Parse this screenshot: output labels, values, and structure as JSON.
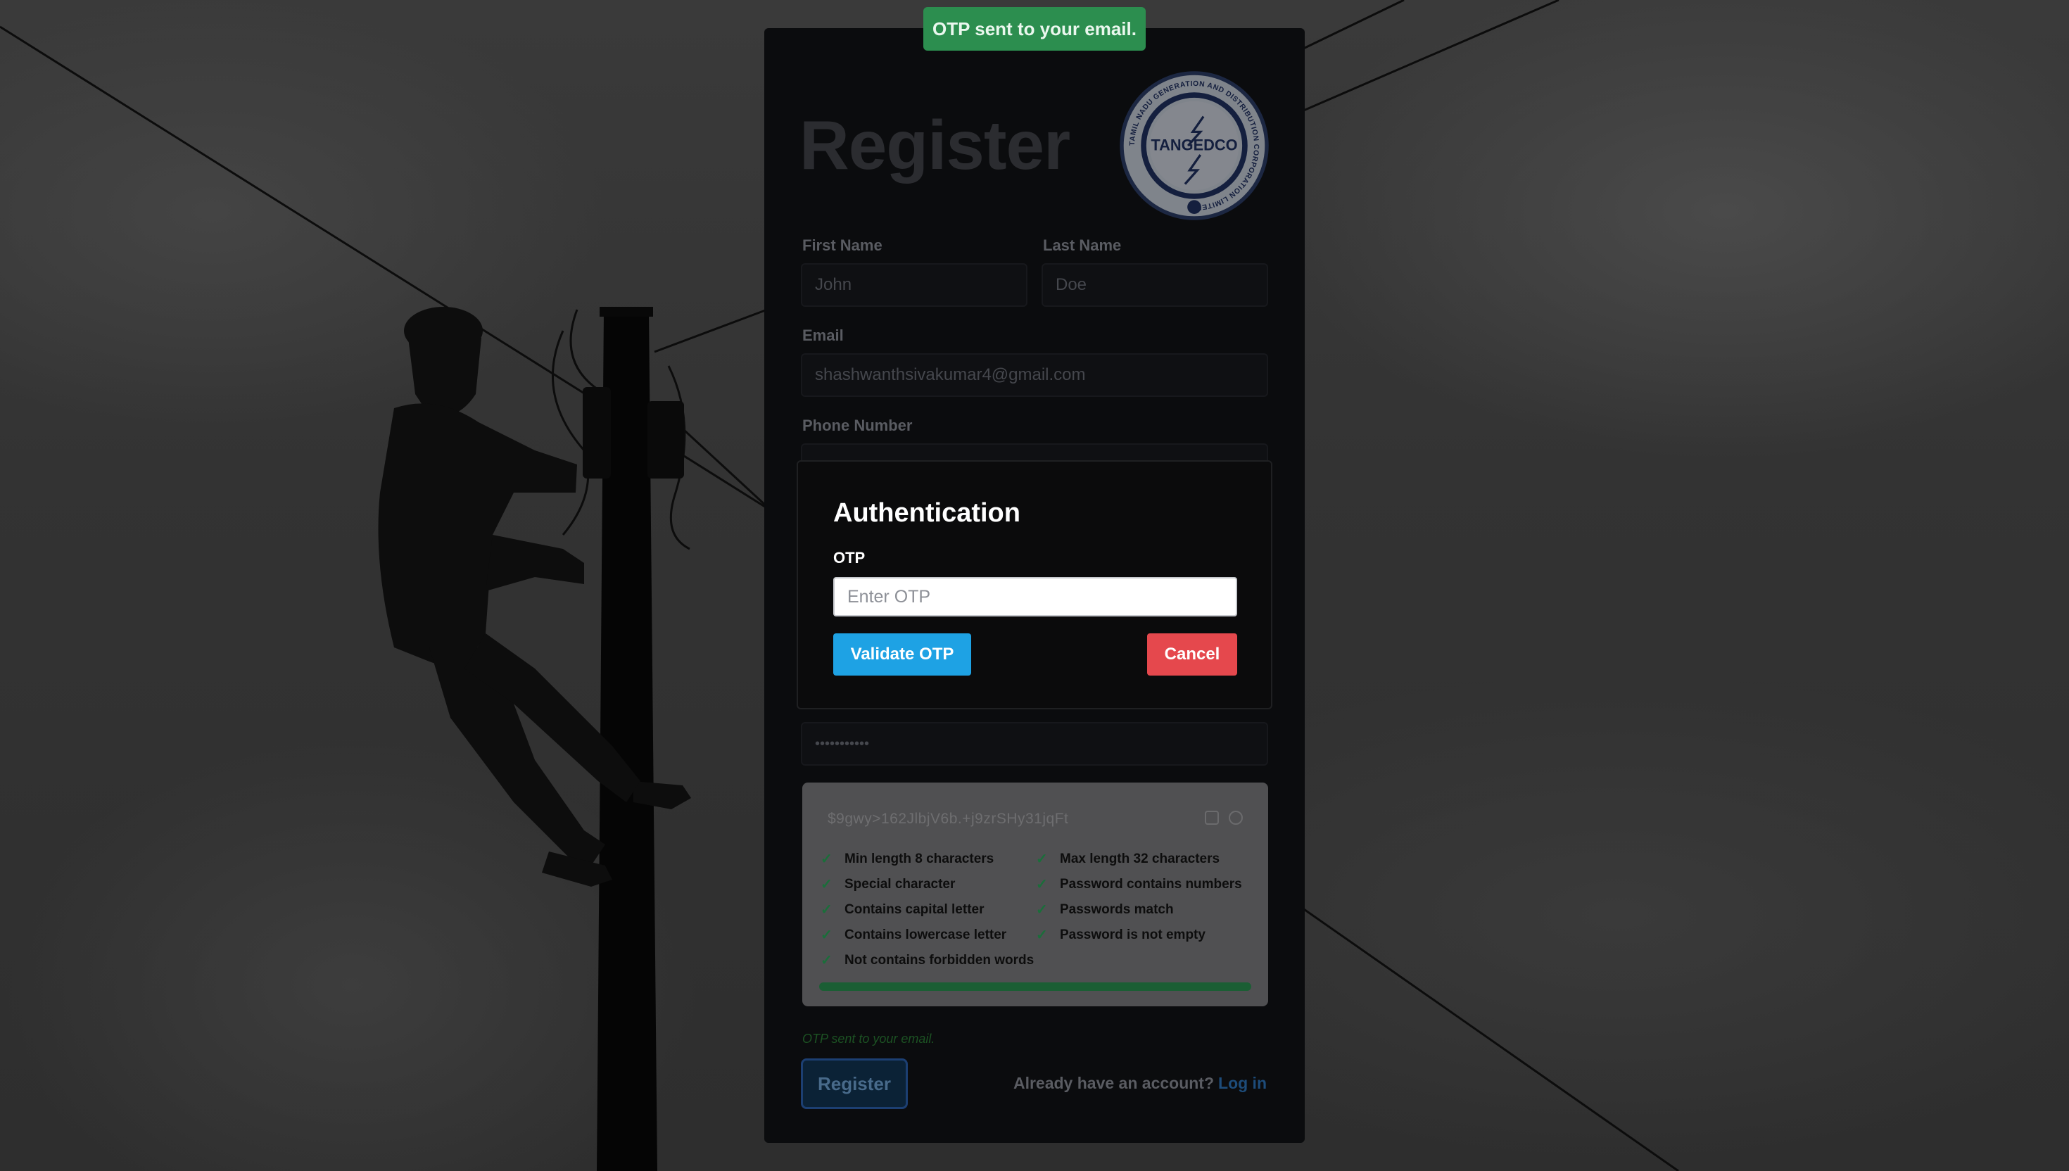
{
  "toast": {
    "message": "OTP sent to your email."
  },
  "form": {
    "title": "Register",
    "logo_text": "TANGEDCO",
    "logo_ring_text": "TAMIL NADU GENERATION AND DISTRIBUTION CORPORATION LIMITED",
    "fields": {
      "first_name": {
        "label": "First Name",
        "value": "John"
      },
      "last_name": {
        "label": "Last Name",
        "value": "Doe"
      },
      "email": {
        "label": "Email",
        "value": "shashwanthsivakumar4@gmail.com"
      },
      "phone": {
        "label": "Phone Number",
        "value": "••••••••••"
      },
      "confirm_password": {
        "value": "•••••••••••"
      }
    },
    "password_checker": {
      "generated_password": "$9gwy>162JlbjV6b.+j9zrSHy31jqFt",
      "rules_left": [
        "Min length 8 characters",
        "Special character",
        "Contains capital letter",
        "Contains lowercase letter",
        "Not contains forbidden words"
      ],
      "rules_right": [
        "Max length 32 characters",
        "Password contains numbers",
        "Passwords match",
        "Password is not empty"
      ],
      "strength": 1.0,
      "check_glyph": "✓"
    },
    "status_note": "OTP sent to your email.",
    "register_label": "Register",
    "login_prompt": "Already have an account?",
    "login_link": "Log in"
  },
  "modal": {
    "title": "Authentication",
    "otp_label": "OTP",
    "otp_placeholder": "Enter OTP",
    "validate_label": "Validate OTP",
    "cancel_label": "Cancel"
  },
  "colors": {
    "toast": "#2c8e4f",
    "validate": "#1ea2e4",
    "cancel": "#e5484d",
    "strength_bar": "#1b5e34"
  }
}
